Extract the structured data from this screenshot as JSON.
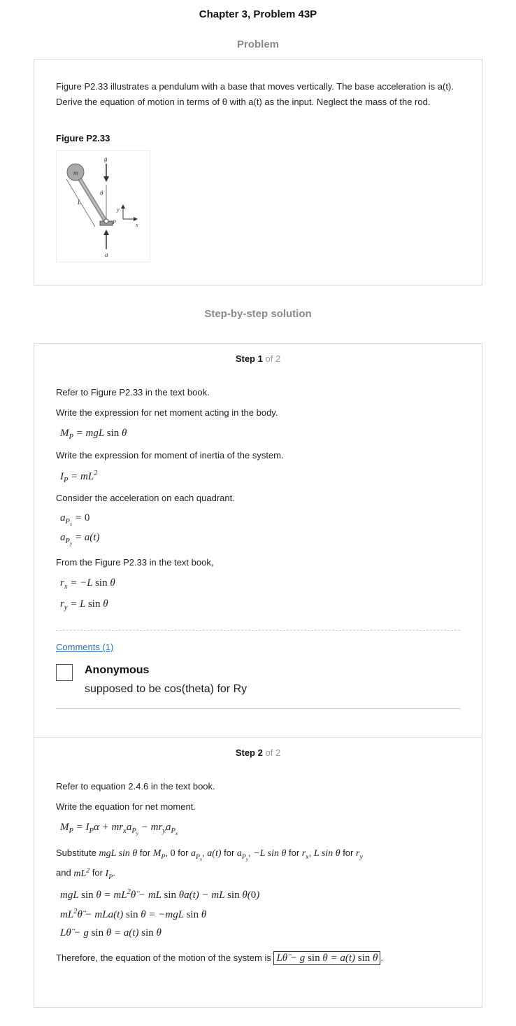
{
  "header": {
    "title": "Chapter 3, Problem 43P",
    "problem_heading": "Problem",
    "solution_heading": "Step-by-step solution"
  },
  "problem": {
    "text": "Figure P2.33 illustrates a pendulum with a base that moves vertically. The base acceleration is a(t). Derive the equation of motion in terms of θ with a(t) as the input. Neglect the mass of the rod.",
    "figure_caption": "Figure P2.33",
    "figure_labels": {
      "g": "g",
      "m": "m",
      "theta": "θ",
      "L": "L",
      "y": "y",
      "x": "x",
      "P": "P",
      "a": "a"
    }
  },
  "step1": {
    "label_step": "Step",
    "number": "1",
    "of": "of 2",
    "line1": "Refer to Figure P2.33 in the text book.",
    "line2": "Write the expression for net moment acting in the body.",
    "line3": "Write the expression for moment of inertia of the system.",
    "line4": "Consider the acceleration on each quadrant.",
    "line5": "From the Figure P2.33 in the text book,",
    "comments_link": "Comments (1)",
    "comment_author": "Anonymous",
    "comment_text": "supposed to be cos(theta) for Ry"
  },
  "step2": {
    "label_step": "Step",
    "number": "2",
    "of": "of 2",
    "line1": "Refer to equation 2.4.6 in the text book.",
    "line2": "Write the equation for net moment.",
    "line3_prefix": "Substitute",
    "line4_prefix": "and",
    "conclusion": "Therefore, the equation of the motion of the system is"
  },
  "colors": {
    "link": "#2a6fb5",
    "muted": "#8a8a8a",
    "border": "#d9d9d9"
  }
}
